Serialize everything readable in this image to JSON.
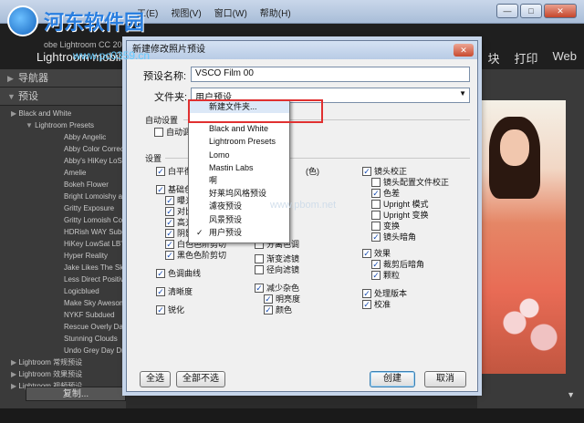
{
  "watermark": {
    "text": "河东软件园",
    "url": "www.pc0359.cn"
  },
  "window": {
    "menu": [
      "工(E)",
      "视图(V)",
      "窗口(W)",
      "帮助(H)"
    ],
    "controls": [
      "—",
      "□",
      "✕"
    ]
  },
  "lightroom": {
    "version": "obe Lightroom CC 2015",
    "brand": "Lightroom mobile",
    "modules": [
      "块",
      "打印",
      "Web"
    ]
  },
  "left_panel": {
    "navigator": "导航器",
    "presets": "预设",
    "items": [
      {
        "label": "Black and White",
        "kind": "folder"
      },
      {
        "label": "Lightroom Presets",
        "kind": "folder-open"
      },
      {
        "label": "Abby Angelic",
        "kind": "leaf"
      },
      {
        "label": "Abby Color Correct",
        "kind": "leaf"
      },
      {
        "label": "Abby's HiKey LoSat",
        "kind": "leaf"
      },
      {
        "label": "Amelie",
        "kind": "leaf"
      },
      {
        "label": "Bokeh Flower",
        "kind": "leaf"
      },
      {
        "label": "Bright Lomoishy a",
        "kind": "leaf"
      },
      {
        "label": "Gritty Exposure",
        "kind": "leaf"
      },
      {
        "label": "Gritty Lomoish Con",
        "kind": "leaf"
      },
      {
        "label": "HDRish WAY Subdu",
        "kind": "leaf"
      },
      {
        "label": "HiKey LowSat LB'd",
        "kind": "leaf"
      },
      {
        "label": "Hyper Reality",
        "kind": "leaf"
      },
      {
        "label": "Jake Likes The Sky",
        "kind": "leaf"
      },
      {
        "label": "Less Direct Positive",
        "kind": "leaf"
      },
      {
        "label": "Logicblued",
        "kind": "leaf"
      },
      {
        "label": "Make Sky Awesome",
        "kind": "leaf"
      },
      {
        "label": "NYKF Subdued",
        "kind": "leaf"
      },
      {
        "label": "Rescue Overly Dark",
        "kind": "leaf"
      },
      {
        "label": "Stunning Clouds",
        "kind": "leaf"
      },
      {
        "label": "Undo Grey Day Dra",
        "kind": "leaf"
      },
      {
        "label": "Lightroom 常规预设",
        "kind": "folder"
      },
      {
        "label": "Lightroom 效果预设",
        "kind": "folder"
      },
      {
        "label": "Lightroom 视频预设",
        "kind": "folder"
      }
    ],
    "copy_button": "复制..."
  },
  "dialog": {
    "title": "新建修改照片预设",
    "close": "✕",
    "name_label": "预设名称:",
    "name_value": "VSCO Film 00",
    "folder_label": "文件夹:",
    "folder_value": "用户预设",
    "auto_section": "自动设置",
    "auto_checkbox": "自动调",
    "settings_section": "设置",
    "col1": [
      "白平衡",
      "基础色调",
      "曝光",
      "对比",
      "高光",
      "阴影",
      "白色色阶剪切",
      "黑色色阶剪切",
      "色调曲线",
      "清晰度",
      "锐化"
    ],
    "col2": [
      "分离色调",
      "渐变滤镜",
      "径向滤镜",
      "减少杂色",
      "明亮度",
      "颜色"
    ],
    "col2_partial": "(色)",
    "col3": [
      "镜头校正",
      "镜头配置文件校正",
      "色差",
      "Upright 模式",
      "Upright 变换",
      "变换",
      "镜头暗角",
      "效果",
      "裁剪后暗角",
      "颗粒",
      "处理版本",
      "校准"
    ],
    "select_all": "全选",
    "select_none": "全部不选",
    "create": "创建",
    "cancel": "取消"
  },
  "dropdown": {
    "items": [
      "新建文件夹...",
      "Black and White",
      "Lightroom Presets",
      "Lomo",
      "Mastin Labs",
      "啊",
      "好莱坞风格预设",
      "濾夜预设",
      "风景预设",
      "用户预设"
    ],
    "checked_index": 9
  },
  "overlay_text": "www.pbom.net",
  "colors": {
    "highlight": "#e03030",
    "accent": "#1a4fb3"
  }
}
